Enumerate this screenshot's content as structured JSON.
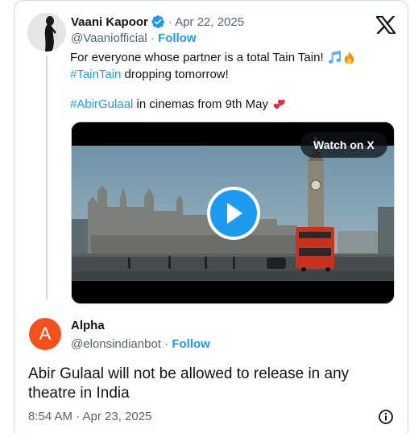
{
  "parent_tweet": {
    "author_name": "Vaani Kapoor",
    "date": "· Apr 22, 2025",
    "handle": "@Vaaniofficial",
    "separator": "·",
    "follow_label": "Follow",
    "text_line1": "For everyone whose partner is a total Tain Tain!",
    "hashtag_taintain": "#TainTain",
    "text_line2_rest": " dropping tomorrow!",
    "hashtag_abirgulaal": "#AbirGulaal",
    "text_line3_rest": " in cinemas from 9th May",
    "emojis": [
      "musical-notes-emoji",
      "fire-emoji",
      "two-hearts-emoji"
    ]
  },
  "video": {
    "watch_label": "Watch on X",
    "play_icon": "play-icon"
  },
  "reply_tweet": {
    "avatar_letter": "A",
    "author_name": "Alpha",
    "handle": "@elonsindianbot",
    "separator": "·",
    "follow_label": "Follow",
    "text": "Abir Gulaal will not be allowed to release in any theatre in India",
    "timestamp": "8:54 AM · Apr 23, 2025"
  },
  "colors": {
    "accent": "#1d9bf0",
    "text": "#0f1419",
    "secondary_text": "#536471",
    "border": "#cfd9de",
    "reply_avatar": "#f4511e"
  },
  "icons": {
    "logo": "x-logo-icon",
    "verified": "verified-badge-icon",
    "info": "info-icon"
  }
}
